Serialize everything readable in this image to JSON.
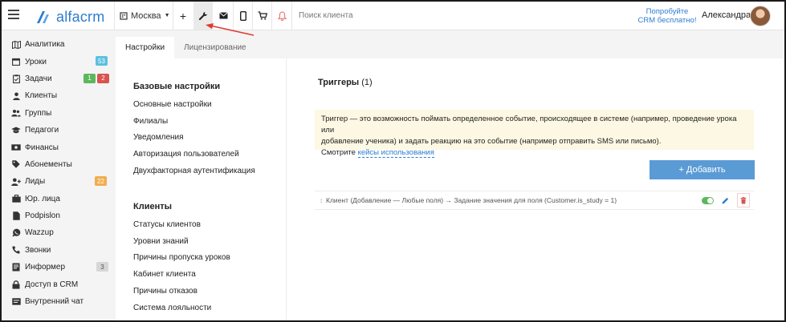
{
  "header": {
    "logo_text": "alfacrm",
    "city": "Москва",
    "search_placeholder": "Поиск клиента",
    "trial_line1": "Попробуйте",
    "trial_line2": "CRM бесплатно!",
    "user_name": "Александра"
  },
  "sidebar": {
    "items": [
      {
        "label": "Аналитика",
        "icon": "map-icon"
      },
      {
        "label": "Уроки",
        "icon": "calendar-icon",
        "badges": [
          "53"
        ]
      },
      {
        "label": "Задачи",
        "icon": "clipboard-icon",
        "badges": [
          "1",
          "2"
        ]
      },
      {
        "label": "Клиенты",
        "icon": "user-icon"
      },
      {
        "label": "Группы",
        "icon": "users-icon"
      },
      {
        "label": "Педагоги",
        "icon": "graduation-cap-icon"
      },
      {
        "label": "Финансы",
        "icon": "money-icon"
      },
      {
        "label": "Абонементы",
        "icon": "tag-icon"
      },
      {
        "label": "Лиды",
        "icon": "user-plus-icon",
        "badges": [
          "22"
        ]
      },
      {
        "label": "Юр. лица",
        "icon": "briefcase-icon"
      },
      {
        "label": "Podpislon",
        "icon": "document-icon"
      },
      {
        "label": "Wazzup",
        "icon": "whatsapp-icon"
      },
      {
        "label": "Звонки",
        "icon": "phone-icon"
      },
      {
        "label": "Информер",
        "icon": "book-icon",
        "badges": [
          "3"
        ]
      },
      {
        "label": "Доступ в CRM",
        "icon": "lock-icon"
      },
      {
        "label": "Внутренний чат",
        "icon": "chat-icon"
      }
    ]
  },
  "tabs": [
    {
      "label": "Настройки",
      "active": true
    },
    {
      "label": "Лицензирование",
      "active": false
    }
  ],
  "settings": {
    "basic_title": "Базовые настройки",
    "basic_links": [
      "Основные настройки",
      "Филиалы",
      "Уведомления",
      "Авторизация пользователей",
      "Двухфакторная аутентификация"
    ],
    "clients_title": "Клиенты",
    "clients_links": [
      "Статусы клиентов",
      "Уровни знаний",
      "Причины пропуска уроков",
      "Кабинет клиента",
      "Причины отказов",
      "Система лояльности"
    ]
  },
  "triggers": {
    "title": "Триггеры",
    "count": "(1)",
    "note_line1": "Триггер — это возможность поймать определенное событие, происходящее в системе (например, проведение урока или",
    "note_line2": "добавление ученика) и задать реакцию на это событие (например отправить SMS или письмо).",
    "note_prefix": "Смотрите ",
    "note_link": "кейсы использования",
    "add_button": "+ Добавить",
    "rows": [
      {
        "text": "Клиент (Добавление — Любые поля) → Задание значения для поля (Customer.is_study = 1)",
        "enabled": true
      }
    ]
  },
  "colors": {
    "brand": "#2e7bd0",
    "add_button": "#5b9bd5",
    "note_bg": "#fdf8e4",
    "annotation_arrow": "#e03a2f"
  }
}
